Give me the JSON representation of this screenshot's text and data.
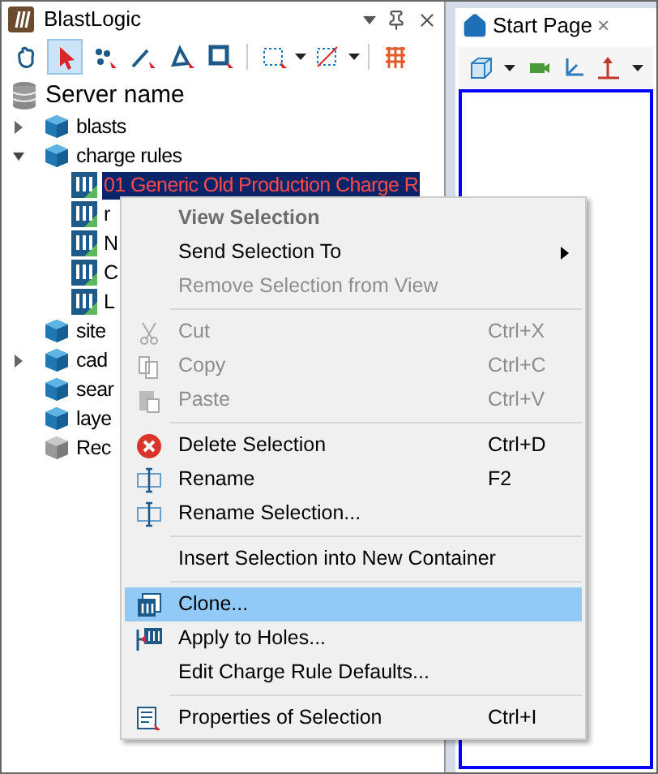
{
  "panel": {
    "title": "BlastLogic"
  },
  "toolbar": [
    {
      "selected": false
    },
    {
      "selected": true
    },
    {
      "selected": false
    },
    {
      "selected": false
    },
    {
      "selected": false
    },
    {
      "selected": false
    },
    {
      "selected": false
    },
    {
      "selected": false
    },
    {
      "selected": false
    }
  ],
  "tree": {
    "root": "Server name",
    "items": [
      {
        "label": "blasts",
        "kind": "folder",
        "expanded": false
      },
      {
        "label": "charge rules",
        "kind": "folder",
        "expanded": true,
        "children": [
          {
            "label": "01 Generic Old Production Charge R",
            "kind": "rule",
            "selected": true
          },
          {
            "label": "r",
            "kind": "rule",
            "selected": false
          },
          {
            "label": "N",
            "kind": "rule",
            "selected": false
          },
          {
            "label": "C",
            "kind": "rule",
            "selected": false
          },
          {
            "label": "L",
            "kind": "rule",
            "selected": false
          }
        ]
      },
      {
        "label": "site",
        "kind": "folder"
      },
      {
        "label": "cad",
        "kind": "folder",
        "expanded": false
      },
      {
        "label": "sear",
        "kind": "folder"
      },
      {
        "label": "laye",
        "kind": "folder"
      },
      {
        "label": "Rec",
        "kind": "recycle"
      }
    ]
  },
  "document_tab": {
    "label": "Start Page",
    "close": "×",
    "selected": true
  },
  "context_menu": [
    {
      "kind": "heading",
      "label": "View Selection"
    },
    {
      "kind": "item",
      "label": "Send Selection To",
      "submenu": true,
      "disabled": false,
      "selected": false
    },
    {
      "kind": "item",
      "label": "Remove Selection from View",
      "disabled": true,
      "selected": false
    },
    {
      "kind": "separator"
    },
    {
      "kind": "item",
      "label": "Cut",
      "shortcut": "Ctrl+X",
      "disabled": true,
      "selected": false
    },
    {
      "kind": "item",
      "label": "Copy",
      "shortcut": "Ctrl+C",
      "disabled": true,
      "selected": false
    },
    {
      "kind": "item",
      "label": "Paste",
      "shortcut": "Ctrl+V",
      "disabled": true,
      "selected": false
    },
    {
      "kind": "separator"
    },
    {
      "kind": "item",
      "label": "Delete Selection",
      "shortcut": "Ctrl+D",
      "disabled": false,
      "selected": false
    },
    {
      "kind": "item",
      "label": "Rename",
      "shortcut": "F2",
      "disabled": false,
      "selected": false
    },
    {
      "kind": "item",
      "label": "Rename Selection...",
      "disabled": false,
      "selected": false
    },
    {
      "kind": "separator"
    },
    {
      "kind": "item",
      "label": "Insert Selection into New Container",
      "disabled": false,
      "selected": false
    },
    {
      "kind": "separator"
    },
    {
      "kind": "item",
      "label": "Clone...",
      "disabled": false,
      "selected": true
    },
    {
      "kind": "item",
      "label": "Apply to Holes...",
      "disabled": false,
      "selected": false
    },
    {
      "kind": "item",
      "label": "Edit Charge Rule Defaults...",
      "disabled": false,
      "selected": false
    },
    {
      "kind": "separator"
    },
    {
      "kind": "item",
      "label": "Properties of Selection",
      "shortcut": "Ctrl+I",
      "disabled": false,
      "selected": false
    }
  ]
}
